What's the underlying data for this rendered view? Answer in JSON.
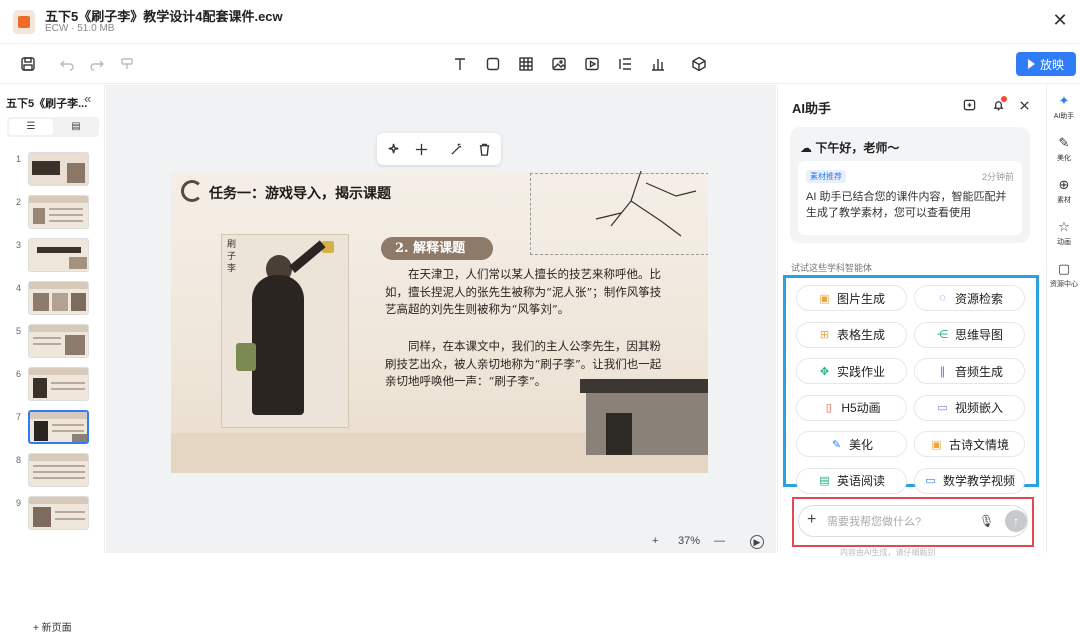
{
  "window": {
    "file_title": "五下5《刷子李》教学设计4配套课件.ecw",
    "file_meta": "ECW · 51.0 MB",
    "close_glyph": "✕"
  },
  "toolbar": {
    "play_label": "放映",
    "accent": "#2f7cf6"
  },
  "left_pane": {
    "title": "五下5《刷子李...",
    "collapse_glyph": "«",
    "view_toggle": [
      "☰",
      "▤"
    ],
    "slides": [
      "1",
      "2",
      "3",
      "4",
      "5",
      "6",
      "7",
      "8",
      "9"
    ],
    "selected_slide": "7",
    "new_page_label": "+ 新页面"
  },
  "slide": {
    "heading": "任务一：游戏导入，揭示课题",
    "portrait_label": "刷子李",
    "pill": "2. 解释课题",
    "para1": "在天津卫，人们常以某人擅长的技艺来称呼他。比如，擅长捏泥人的张先生被称为“泥人张”；制作风筝技艺高超的刘先生则被称为“风筝刘”。",
    "para2": "同样，在本课文中，我们的主人公李先生，因其粉刷技艺出众，被人亲切地称为“刷子李”。让我们也一起亲切地呼唤他一声：“刷子李”。"
  },
  "zoom": {
    "plus": "+",
    "level": "37%",
    "minus": "—",
    "play": "▶"
  },
  "ai_panel": {
    "title": "AI助手",
    "greeting": "下午好，老师～",
    "message": {
      "tag": "素材推荐",
      "time": "2分钟前",
      "text": "AI 助手已结合您的课件内容，智能匹配并生成了教学素材，您可以查看使用"
    },
    "try_label": "试试这些学科智能体",
    "agents": [
      {
        "label": "图片生成",
        "icon": "▣",
        "color": "#e8a93a"
      },
      {
        "label": "资源检索",
        "icon": "◌",
        "color": "#2f7cf6"
      },
      {
        "label": "表格生成",
        "icon": "⊞",
        "color": "#e8a93a"
      },
      {
        "label": "思维导图",
        "icon": "⋲",
        "color": "#21b08a"
      },
      {
        "label": "实践作业",
        "icon": "✥",
        "color": "#21b08a"
      },
      {
        "label": "音频生成",
        "icon": "∥",
        "color": "#2f7cf6"
      },
      {
        "label": "H5动画",
        "icon": "▯",
        "color": "#e55a4e"
      },
      {
        "label": "视频嵌入",
        "icon": "▭",
        "color": "#8a6fe8"
      },
      {
        "label": "美化",
        "icon": "✎",
        "color": "#2f7cf6"
      },
      {
        "label": "古诗文情境",
        "icon": "▣",
        "color": "#e8a93a"
      },
      {
        "label": "英语阅读",
        "icon": "▤",
        "color": "#21b08a"
      },
      {
        "label": "数学教学视频",
        "icon": "▭",
        "color": "#2f7cf6"
      }
    ],
    "input_placeholder": "需要我帮您做什么?",
    "disclaimer": "内容由AI生成，请仔细甄别"
  },
  "right_rail": [
    {
      "label": "AI助手",
      "icon": "✦"
    },
    {
      "label": "美化",
      "icon": "✎"
    },
    {
      "label": "素材",
      "icon": "⊕"
    },
    {
      "label": "动画",
      "icon": "☆"
    },
    {
      "label": "资源中心",
      "icon": "▢"
    }
  ]
}
